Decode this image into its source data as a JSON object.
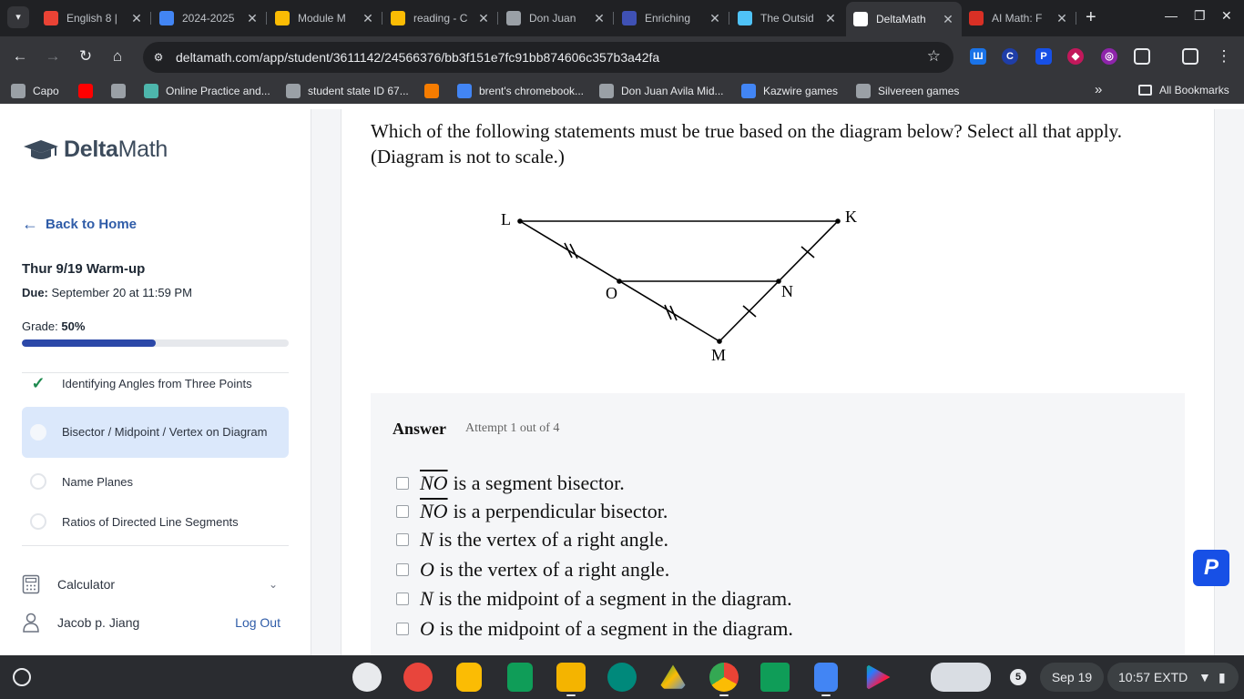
{
  "browser": {
    "tabs": [
      {
        "title": "English 8 |",
        "color": "#ea4335"
      },
      {
        "title": "2024-2025",
        "color": "#4285f4"
      },
      {
        "title": "Module M",
        "color": "#fbbc04"
      },
      {
        "title": "reading - C",
        "color": "#fbbc04"
      },
      {
        "title": "Don Juan",
        "color": "#9aa0a6"
      },
      {
        "title": "Enriching",
        "color": "#3f51b5"
      },
      {
        "title": "The Outsid",
        "color": "#4fc3f7"
      },
      {
        "title": "DeltaMath",
        "color": "#ffffff"
      },
      {
        "title": "AI Math: F",
        "color": "#d93025"
      }
    ],
    "url": "deltamath.com/app/student/3611142/24566376/bb3f151e7fc91bb874606c357b3a42fa",
    "bookmarks": [
      {
        "label": "Capo",
        "color": "#9aa0a6"
      },
      {
        "label": "",
        "color": "#ff0000"
      },
      {
        "label": "",
        "color": "#9aa0a6"
      },
      {
        "label": "Online Practice and...",
        "color": "#4db6ac"
      },
      {
        "label": "student state ID 67...",
        "color": "#9aa0a6"
      },
      {
        "label": "",
        "color": "#f57c00"
      },
      {
        "label": "brent's chromebook...",
        "color": "#4285f4"
      },
      {
        "label": "Don Juan Avila Mid...",
        "color": "#9aa0a6"
      },
      {
        "label": "Kazwire games",
        "color": "#4285f4"
      },
      {
        "label": "Silvereen games",
        "color": "#9aa0a6"
      }
    ],
    "all_bookmarks": "All Bookmarks"
  },
  "sidebar": {
    "logo": "DeltaMath",
    "back": "Back to Home",
    "assignment_title": "Thur 9/19 Warm-up",
    "due_label": "Due:",
    "due_value": "September 20 at 11:59 PM",
    "grade_label": "Grade:",
    "grade_value": "50%",
    "grade_fraction": 0.5,
    "skills": [
      {
        "label": "Identifying Angles from Three Points",
        "status": "complete"
      },
      {
        "label": "Bisector / Midpoint / Vertex on Diagram",
        "status": "active"
      },
      {
        "label": "Name Planes",
        "status": "todo"
      },
      {
        "label": "Ratios of Directed Line Segments",
        "status": "todo"
      }
    ],
    "calculator": "Calculator",
    "user": "Jacob p. Jiang",
    "logout": "Log Out"
  },
  "problem": {
    "question": "Which of the following statements must be true based on the diagram below? Select all that apply. (Diagram is not to scale.)",
    "diagram_labels": {
      "L": "L",
      "K": "K",
      "O": "O",
      "N": "N",
      "M": "M"
    },
    "answer_label": "Answer",
    "attempt": "Attempt 1 out of 4",
    "choices": [
      {
        "subject": "NO",
        "type": "segment",
        "rest": "is a segment bisector."
      },
      {
        "subject": "NO",
        "type": "segment",
        "rest": "is a perpendicular bisector."
      },
      {
        "subject": "N",
        "type": "point",
        "rest": "is the vertex of a right angle."
      },
      {
        "subject": "O",
        "type": "point",
        "rest": "is the vertex of a right angle."
      },
      {
        "subject": "N",
        "type": "point",
        "rest": "is the midpoint of a segment in the diagram."
      },
      {
        "subject": "O",
        "type": "point",
        "rest": "is the midpoint of a segment in the diagram."
      }
    ]
  },
  "shelf": {
    "notifications": "5",
    "date": "Sep 19",
    "time": "10:57  EXTD"
  }
}
